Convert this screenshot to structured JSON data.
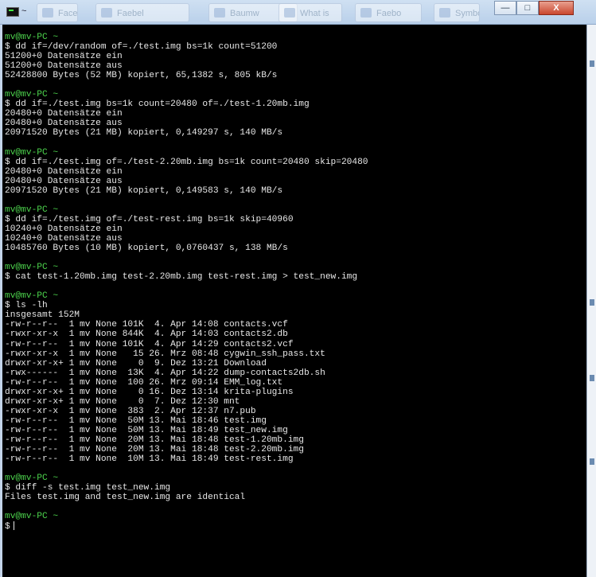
{
  "window": {
    "title": "~"
  },
  "background_tabs": [
    "Facebo",
    "Faebel",
    "Baumw",
    "What is",
    "Faebo",
    "Symbol"
  ],
  "window_buttons": {
    "minimize": "—",
    "restore": "□",
    "close": "X"
  },
  "terminal": {
    "lines": [
      {
        "type": "prompt",
        "text": "mv@mv-PC ~"
      },
      {
        "type": "output",
        "text": "$ dd if=/dev/random of=./test.img bs=1k count=51200"
      },
      {
        "type": "output",
        "text": "51200+0 Datensätze ein"
      },
      {
        "type": "output",
        "text": "51200+0 Datensätze aus"
      },
      {
        "type": "output",
        "text": "52428800 Bytes (52 MB) kopiert, 65,1382 s, 805 kB/s"
      },
      {
        "type": "blank",
        "text": ""
      },
      {
        "type": "prompt",
        "text": "mv@mv-PC ~"
      },
      {
        "type": "output",
        "text": "$ dd if=./test.img bs=1k count=20480 of=./test-1.20mb.img"
      },
      {
        "type": "output",
        "text": "20480+0 Datensätze ein"
      },
      {
        "type": "output",
        "text": "20480+0 Datensätze aus"
      },
      {
        "type": "output",
        "text": "20971520 Bytes (21 MB) kopiert, 0,149297 s, 140 MB/s"
      },
      {
        "type": "blank",
        "text": ""
      },
      {
        "type": "prompt",
        "text": "mv@mv-PC ~"
      },
      {
        "type": "output",
        "text": "$ dd if=./test.img of=./test-2.20mb.img bs=1k count=20480 skip=20480"
      },
      {
        "type": "output",
        "text": "20480+0 Datensätze ein"
      },
      {
        "type": "output",
        "text": "20480+0 Datensätze aus"
      },
      {
        "type": "output",
        "text": "20971520 Bytes (21 MB) kopiert, 0,149583 s, 140 MB/s"
      },
      {
        "type": "blank",
        "text": ""
      },
      {
        "type": "prompt",
        "text": "mv@mv-PC ~"
      },
      {
        "type": "output",
        "text": "$ dd if=./test.img of=./test-rest.img bs=1k skip=40960"
      },
      {
        "type": "output",
        "text": "10240+0 Datensätze ein"
      },
      {
        "type": "output",
        "text": "10240+0 Datensätze aus"
      },
      {
        "type": "output",
        "text": "10485760 Bytes (10 MB) kopiert, 0,0760437 s, 138 MB/s"
      },
      {
        "type": "blank",
        "text": ""
      },
      {
        "type": "prompt",
        "text": "mv@mv-PC ~"
      },
      {
        "type": "output",
        "text": "$ cat test-1.20mb.img test-2.20mb.img test-rest.img > test_new.img"
      },
      {
        "type": "blank",
        "text": ""
      },
      {
        "type": "prompt",
        "text": "mv@mv-PC ~"
      },
      {
        "type": "output",
        "text": "$ ls -lh"
      },
      {
        "type": "output",
        "text": "insgesamt 152M"
      },
      {
        "type": "output",
        "text": "-rw-r--r--  1 mv None 101K  4. Apr 14:08 contacts.vcf"
      },
      {
        "type": "output",
        "text": "-rwxr-xr-x  1 mv None 844K  4. Apr 14:03 contacts2.db"
      },
      {
        "type": "output",
        "text": "-rw-r--r--  1 mv None 101K  4. Apr 14:29 contacts2.vcf"
      },
      {
        "type": "output",
        "text": "-rwxr-xr-x  1 mv None   15 26. Mrz 08:48 cygwin_ssh_pass.txt"
      },
      {
        "type": "output",
        "text": "drwxr-xr-x+ 1 mv None    0  9. Dez 13:21 Download"
      },
      {
        "type": "output",
        "text": "-rwx------  1 mv None  13K  4. Apr 14:22 dump-contacts2db.sh"
      },
      {
        "type": "output",
        "text": "-rw-r--r--  1 mv None  100 26. Mrz 09:14 EMM_log.txt"
      },
      {
        "type": "output",
        "text": "drwxr-xr-x+ 1 mv None    0 16. Dez 13:14 krita-plugins"
      },
      {
        "type": "output",
        "text": "drwxr-xr-x+ 1 mv None    0  7. Dez 12:30 mnt"
      },
      {
        "type": "output",
        "text": "-rwxr-xr-x  1 mv None  383  2. Apr 12:37 n7.pub"
      },
      {
        "type": "output",
        "text": "-rw-r--r--  1 mv None  50M 13. Mai 18:46 test.img"
      },
      {
        "type": "output",
        "text": "-rw-r--r--  1 mv None  50M 13. Mai 18:49 test_new.img"
      },
      {
        "type": "output",
        "text": "-rw-r--r--  1 mv None  20M 13. Mai 18:48 test-1.20mb.img"
      },
      {
        "type": "output",
        "text": "-rw-r--r--  1 mv None  20M 13. Mai 18:48 test-2.20mb.img"
      },
      {
        "type": "output",
        "text": "-rw-r--r--  1 mv None  10M 13. Mai 18:49 test-rest.img"
      },
      {
        "type": "blank",
        "text": ""
      },
      {
        "type": "prompt",
        "text": "mv@mv-PC ~"
      },
      {
        "type": "output",
        "text": "$ diff -s test.img test_new.img"
      },
      {
        "type": "output",
        "text": "Files test.img and test_new.img are identical"
      },
      {
        "type": "blank",
        "text": ""
      },
      {
        "type": "prompt",
        "text": "mv@mv-PC ~"
      },
      {
        "type": "cursor",
        "text": "$"
      }
    ]
  },
  "colors": {
    "background": "#000000",
    "prompt": "#4cd24c",
    "text": "#e8e8e8"
  }
}
